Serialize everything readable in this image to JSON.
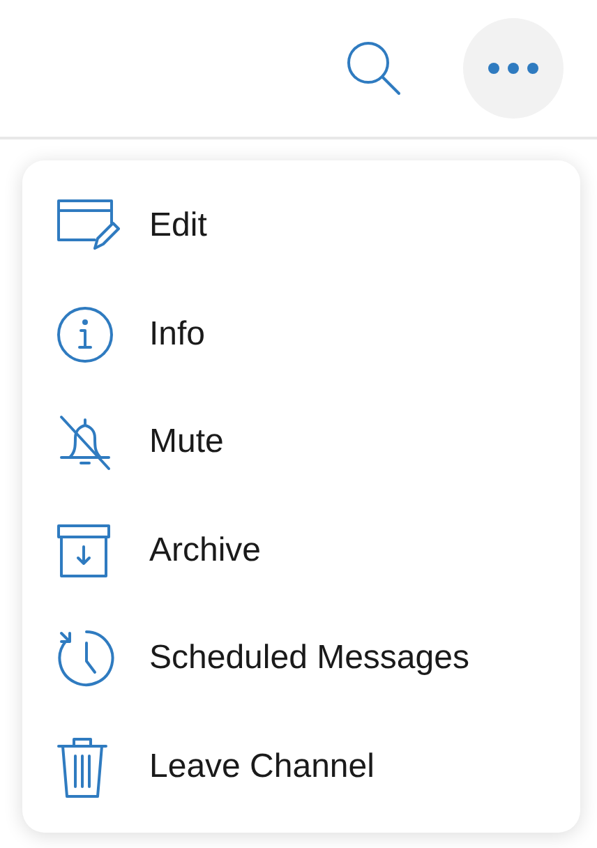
{
  "toolbar": {
    "actions": [
      {
        "kind": "search"
      },
      {
        "kind": "more",
        "selected": true
      }
    ]
  },
  "menu": {
    "items": [
      {
        "kind": "edit",
        "label": "Edit"
      },
      {
        "kind": "info",
        "label": "Info"
      },
      {
        "kind": "mute",
        "label": "Mute"
      },
      {
        "kind": "archive",
        "label": "Archive"
      },
      {
        "kind": "schedule",
        "label": "Scheduled Messages"
      },
      {
        "kind": "trash",
        "label": "Leave Channel"
      }
    ]
  }
}
